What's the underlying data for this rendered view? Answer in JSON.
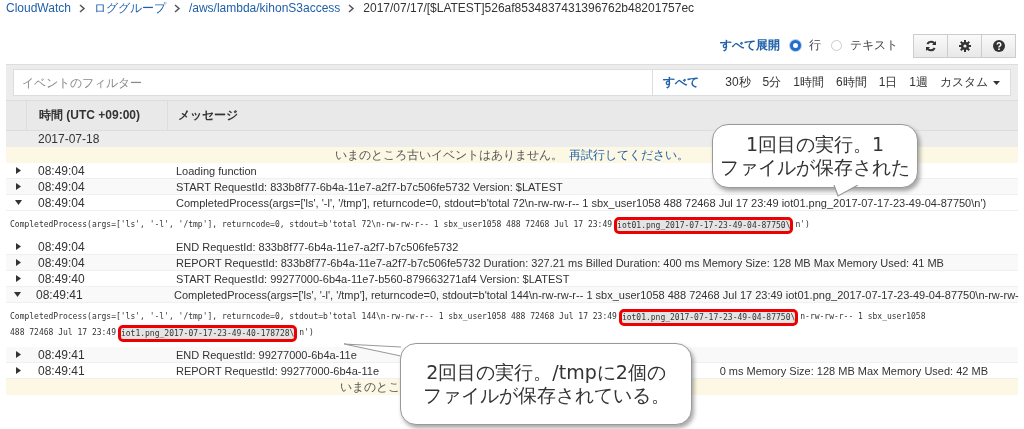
{
  "breadcrumb": [
    {
      "label": "CloudWatch",
      "link": true
    },
    {
      "label": "ロググループ",
      "link": true
    },
    {
      "label": "/aws/lambda/kihonS3access",
      "link": true
    },
    {
      "label": "2017/07/17/[$LATEST]526af8534837431396762b48201757ec",
      "link": false
    }
  ],
  "toolbar": {
    "expand_all": "すべて展開",
    "view_options": [
      {
        "label": "行",
        "selected": true
      },
      {
        "label": "テキスト",
        "selected": false
      }
    ]
  },
  "filter": {
    "placeholder": "イベントのフィルター",
    "ranges": [
      {
        "label": "すべて",
        "selected": true,
        "dropdown": false
      },
      {
        "label": "30秒",
        "selected": false,
        "dropdown": false
      },
      {
        "label": "5分",
        "selected": false,
        "dropdown": false
      },
      {
        "label": "1時間",
        "selected": false,
        "dropdown": false
      },
      {
        "label": "6時間",
        "selected": false,
        "dropdown": false
      },
      {
        "label": "1日",
        "selected": false,
        "dropdown": false
      },
      {
        "label": "1週",
        "selected": false,
        "dropdown": false
      },
      {
        "label": "カスタム",
        "selected": false,
        "dropdown": true
      }
    ]
  },
  "table": {
    "columns": [
      "時間 (UTC +09:00)",
      "メッセージ"
    ],
    "rows": [
      {
        "kind": "date",
        "date": "2017-07-18"
      },
      {
        "kind": "notice",
        "text": "いまのところ古いイベントはありません。",
        "link": "再試行してください。"
      },
      {
        "kind": "event",
        "time": "08:49:04",
        "message": "Loading function",
        "expanded": false
      },
      {
        "kind": "event",
        "time": "08:49:04",
        "message": "START RequestId: 833b8f77-6b4a-11e7-a2f7-b7c506fe5732 Version: $LATEST",
        "expanded": false
      },
      {
        "kind": "event",
        "time": "08:49:04",
        "message": "CompletedProcess(args=['ls', '-l', '/tmp'], returncode=0, stdout=b'total 72\\n-rw-rw-r-- 1 sbx_user1058 488 72468 Jul 17 23:49 iot01.png_2017-07-17-23-49-04-87750\\n')",
        "expanded": true
      },
      {
        "kind": "detail",
        "lines": [
          [
            {
              "text": "CompletedProcess(args=['ls', '-l', '/tmp'], returncode=0, stdout=b'total 72\\n-rw-rw-r-- 1 sbx_user1058 488 72468 Jul 17 23:49",
              "highlighted": false
            },
            {
              "text": "iot01.png_2017-07-17-23-49-04-87750\\",
              "highlighted": true
            },
            {
              "text": "n')",
              "highlighted": false
            }
          ]
        ]
      },
      {
        "kind": "event",
        "time": "08:49:04",
        "message": "END RequestId: 833b8f77-6b4a-11e7-a2f7-b7c506fe5732",
        "expanded": false
      },
      {
        "kind": "event",
        "time": "08:49:04",
        "message": "REPORT RequestId: 833b8f77-6b4a-11e7-a2f7-b7c506fe5732 Duration: 327.21 ms Billed Duration: 400 ms Memory Size: 128 MB Max Memory Used: 41 MB",
        "expanded": false
      },
      {
        "kind": "event",
        "time": "08:49:40",
        "message": "START RequestId: 99277000-6b4a-11e7-b560-879663271af4 Version: $LATEST",
        "expanded": false
      },
      {
        "kind": "event",
        "time": "08:49:41",
        "message": "CompletedProcess(args=['ls', '-l', '/tmp'], returncode=0, stdout=b'total 144\\n-rw-rw-r-- 1 sbx_user1058 488 72468 Jul 17 23:49 iot01.png_2017-07-17-23-49-04-87750\\n-rw-rw-",
        "expanded": true
      },
      {
        "kind": "detail",
        "lines": [
          [
            {
              "text": "CompletedProcess(args=['ls', '-l', '/tmp'], returncode=0, stdout=b'total 144\\n-rw-rw-r-- 1 sbx_user1058 488 72468 Jul 17 23:49",
              "highlighted": false
            },
            {
              "text": "iot01.png_2017-07-17-23-49-04-87750\\",
              "highlighted": true
            },
            {
              "text": "n-rw-rw-r-- 1 sbx_user1058",
              "highlighted": false
            }
          ],
          [
            {
              "text": "488 72468 Jul 17 23:49",
              "highlighted": false
            },
            {
              "text": "iot1.png_2017-07-17-23-49-40-178728\\",
              "highlighted": true
            },
            {
              "text": "n')",
              "highlighted": false
            }
          ]
        ]
      },
      {
        "kind": "event",
        "time": "08:49:41",
        "message": "END RequestId: 99277000-6b4a-11e",
        "expanded": false
      },
      {
        "kind": "event",
        "time": "08:49:41",
        "message": "REPORT RequestId: 99277000-6b4a-11e",
        "message_tail": "0 ms Memory Size: 128 MB Max Memory Used: 42 MB",
        "expanded": false
      },
      {
        "kind": "notice",
        "text": "いまのとこ"
      }
    ]
  },
  "callouts": [
    {
      "lines": [
        "1回目の実行。1",
        "ファイルが保存された"
      ]
    },
    {
      "lines": [
        "2回目の実行。/tmpに2個の",
        "ファイルが保存されている。"
      ]
    }
  ]
}
